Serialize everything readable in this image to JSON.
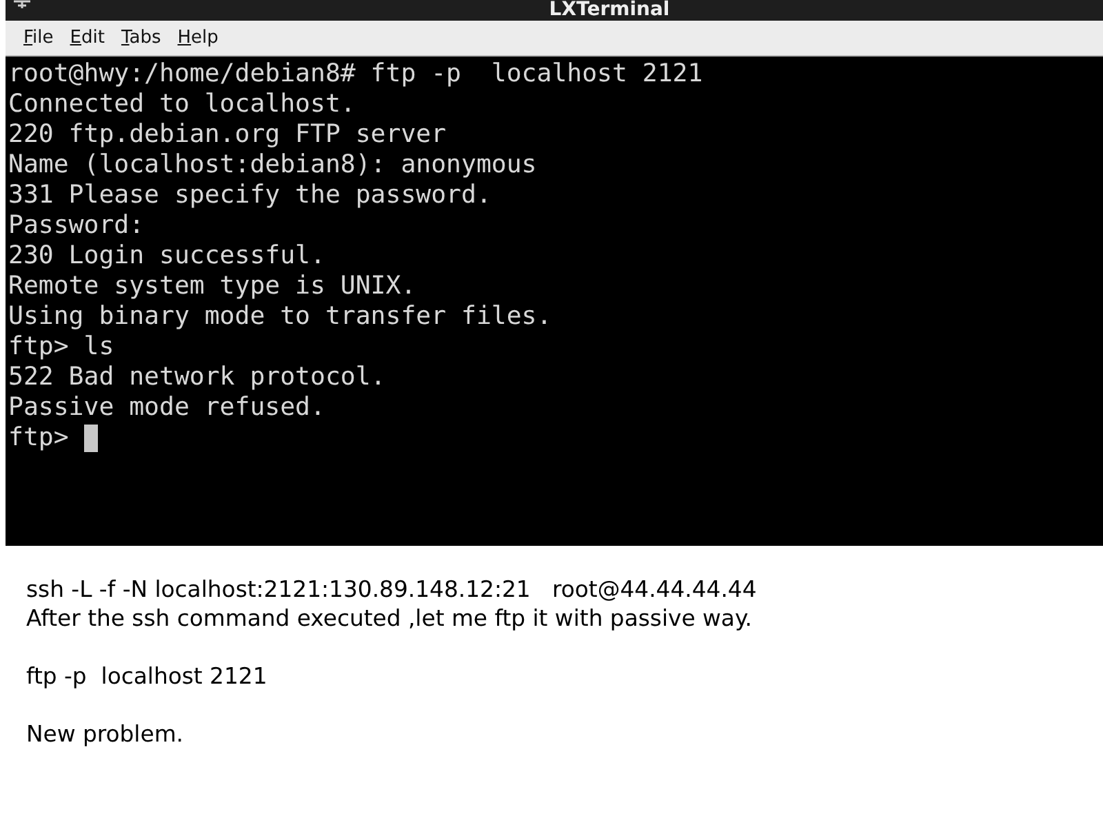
{
  "window": {
    "title": "LXTerminal"
  },
  "menu": [
    "File",
    "Edit",
    "Tabs",
    "Help"
  ],
  "terminal": {
    "lines": [
      "root@hwy:/home/debian8# ftp -p  localhost 2121",
      "Connected to localhost.",
      "220 ftp.debian.org FTP server",
      "Name (localhost:debian8): anonymous",
      "331 Please specify the password.",
      "Password:",
      "230 Login successful.",
      "Remote system type is UNIX.",
      "Using binary mode to transfer files.",
      "ftp> ls",
      "522 Bad network protocol.",
      "Passive mode refused."
    ],
    "prompt": "ftp>",
    "cursor": true
  },
  "note": {
    "paragraphs": [
      [
        "ssh -L -f -N localhost:2121:130.89.148.12:21   root@44.44.44.44",
        "After the ssh command executed ,let me ftp it with passive way."
      ],
      [
        "ftp -p  localhost 2121"
      ],
      [
        "New problem."
      ]
    ]
  }
}
